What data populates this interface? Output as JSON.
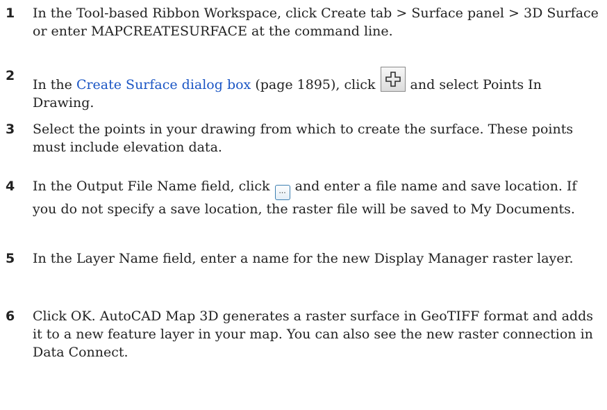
{
  "steps": [
    {
      "num": "1",
      "parts": [
        "In the Tool-based Ribbon Workspace, click Create tab > Surface panel > 3D Surface or enter MAPCREATESURFACE at the command line."
      ]
    },
    {
      "num": "2",
      "before_link": "In the ",
      "link": "Create Surface dialog box",
      "after_link": " (page 1895), click ",
      "after_button": " and select Points In Drawing.",
      "button_icon": "add-plus-icon"
    },
    {
      "num": "3",
      "parts": [
        "Select the points in your drawing from which to create the surface. These points must include elevation data."
      ]
    },
    {
      "num": "4",
      "before_button": "In the Output File Name field, click ",
      "after_button": " and enter a file name and save location. If you do not specify a save location, the raster file will be saved to My Documents.",
      "button_text": "...",
      "button_icon": "browse-ellipsis-icon"
    },
    {
      "num": "5",
      "parts": [
        "In the Layer Name field, enter a name for the new Display Manager raster layer."
      ]
    },
    {
      "num": "6",
      "parts": [
        "Click OK. AutoCAD Map 3D generates a raster surface in GeoTIFF format and adds it to a new feature layer in your map. You can also see the new raster connection in Data Connect."
      ]
    }
  ],
  "colors": {
    "text": "#222222",
    "link": "#1a55c4"
  }
}
